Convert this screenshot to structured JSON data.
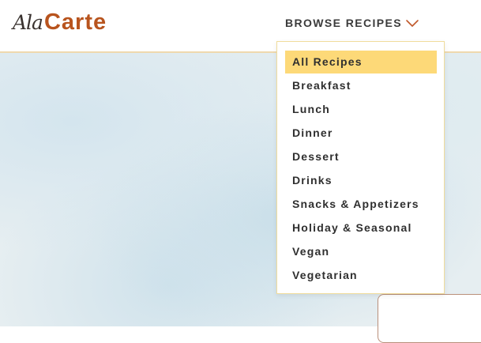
{
  "colors": {
    "brand": "#b8541e",
    "logo_script": "#3a3330",
    "menu_active_bg": "#fdd978",
    "header_border": "#efd9ae",
    "chevron": "#c0582a"
  },
  "header": {
    "logo": {
      "script": "Ala",
      "word": "Carte"
    },
    "browse_label": "BROWSE RECIPES",
    "browse_icon": "chevron-down-icon"
  },
  "dropdown": {
    "items": [
      {
        "label": "All Recipes",
        "active": true
      },
      {
        "label": "Breakfast",
        "active": false
      },
      {
        "label": "Lunch",
        "active": false
      },
      {
        "label": "Dinner",
        "active": false
      },
      {
        "label": "Dessert",
        "active": false
      },
      {
        "label": "Drinks",
        "active": false
      },
      {
        "label": "Snacks & Appetizers",
        "active": false
      },
      {
        "label": "Holiday & Seasonal",
        "active": false
      },
      {
        "label": "Vegan",
        "active": false
      },
      {
        "label": "Vegetarian",
        "active": false
      }
    ]
  }
}
